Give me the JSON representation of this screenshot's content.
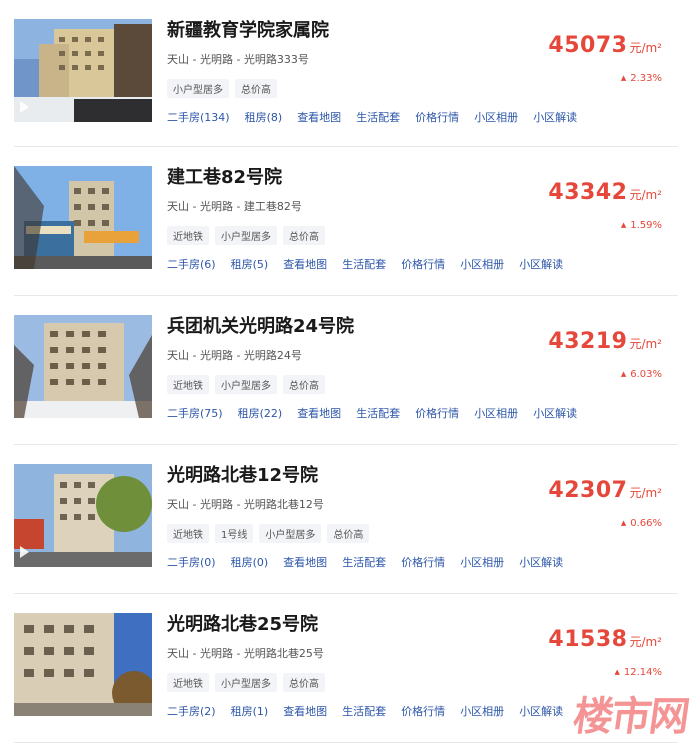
{
  "listings": [
    {
      "title": "新疆教育学院家属院",
      "address": "天山 - 光明路 - 光明路333号",
      "tags": [
        "小户型居多",
        "总价高"
      ],
      "links": [
        "二手房(134)",
        "租房(8)",
        "查看地图",
        "生活配套",
        "价格行情",
        "小区相册",
        "小区解读"
      ],
      "price": "45073",
      "unit": "元/m²",
      "change": "2.33%",
      "video": true
    },
    {
      "title": "建工巷82号院",
      "address": "天山 - 光明路 - 建工巷82号",
      "tags": [
        "近地铁",
        "小户型居多",
        "总价高"
      ],
      "links": [
        "二手房(6)",
        "租房(5)",
        "查看地图",
        "生活配套",
        "价格行情",
        "小区相册",
        "小区解读"
      ],
      "price": "43342",
      "unit": "元/m²",
      "change": "1.59%",
      "video": false
    },
    {
      "title": "兵团机关光明路24号院",
      "address": "天山 - 光明路 - 光明路24号",
      "tags": [
        "近地铁",
        "小户型居多",
        "总价高"
      ],
      "links": [
        "二手房(75)",
        "租房(22)",
        "查看地图",
        "生活配套",
        "价格行情",
        "小区相册",
        "小区解读"
      ],
      "price": "43219",
      "unit": "元/m²",
      "change": "6.03%",
      "video": false
    },
    {
      "title": "光明路北巷12号院",
      "address": "天山 - 光明路 - 光明路北巷12号",
      "tags": [
        "近地铁",
        "1号线",
        "小户型居多",
        "总价高"
      ],
      "links": [
        "二手房(0)",
        "租房(0)",
        "查看地图",
        "生活配套",
        "价格行情",
        "小区相册",
        "小区解读"
      ],
      "price": "42307",
      "unit": "元/m²",
      "change": "0.66%",
      "video": true
    },
    {
      "title": "光明路北巷25号院",
      "address": "天山 - 光明路 - 光明路北巷25号",
      "tags": [
        "近地铁",
        "小户型居多",
        "总价高"
      ],
      "links": [
        "二手房(2)",
        "租房(1)",
        "查看地图",
        "生活配套",
        "价格行情",
        "小区相册",
        "小区解读"
      ],
      "price": "41538",
      "unit": "元/m²",
      "change": "12.14%",
      "video": false
    }
  ],
  "watermark": "楼市网",
  "colors": {
    "price": "#e5483b",
    "link": "#2c56a8",
    "tag_bg": "#f2f4f7"
  },
  "icons": {
    "trend": "triangle-up-icon",
    "video": "play-icon"
  }
}
